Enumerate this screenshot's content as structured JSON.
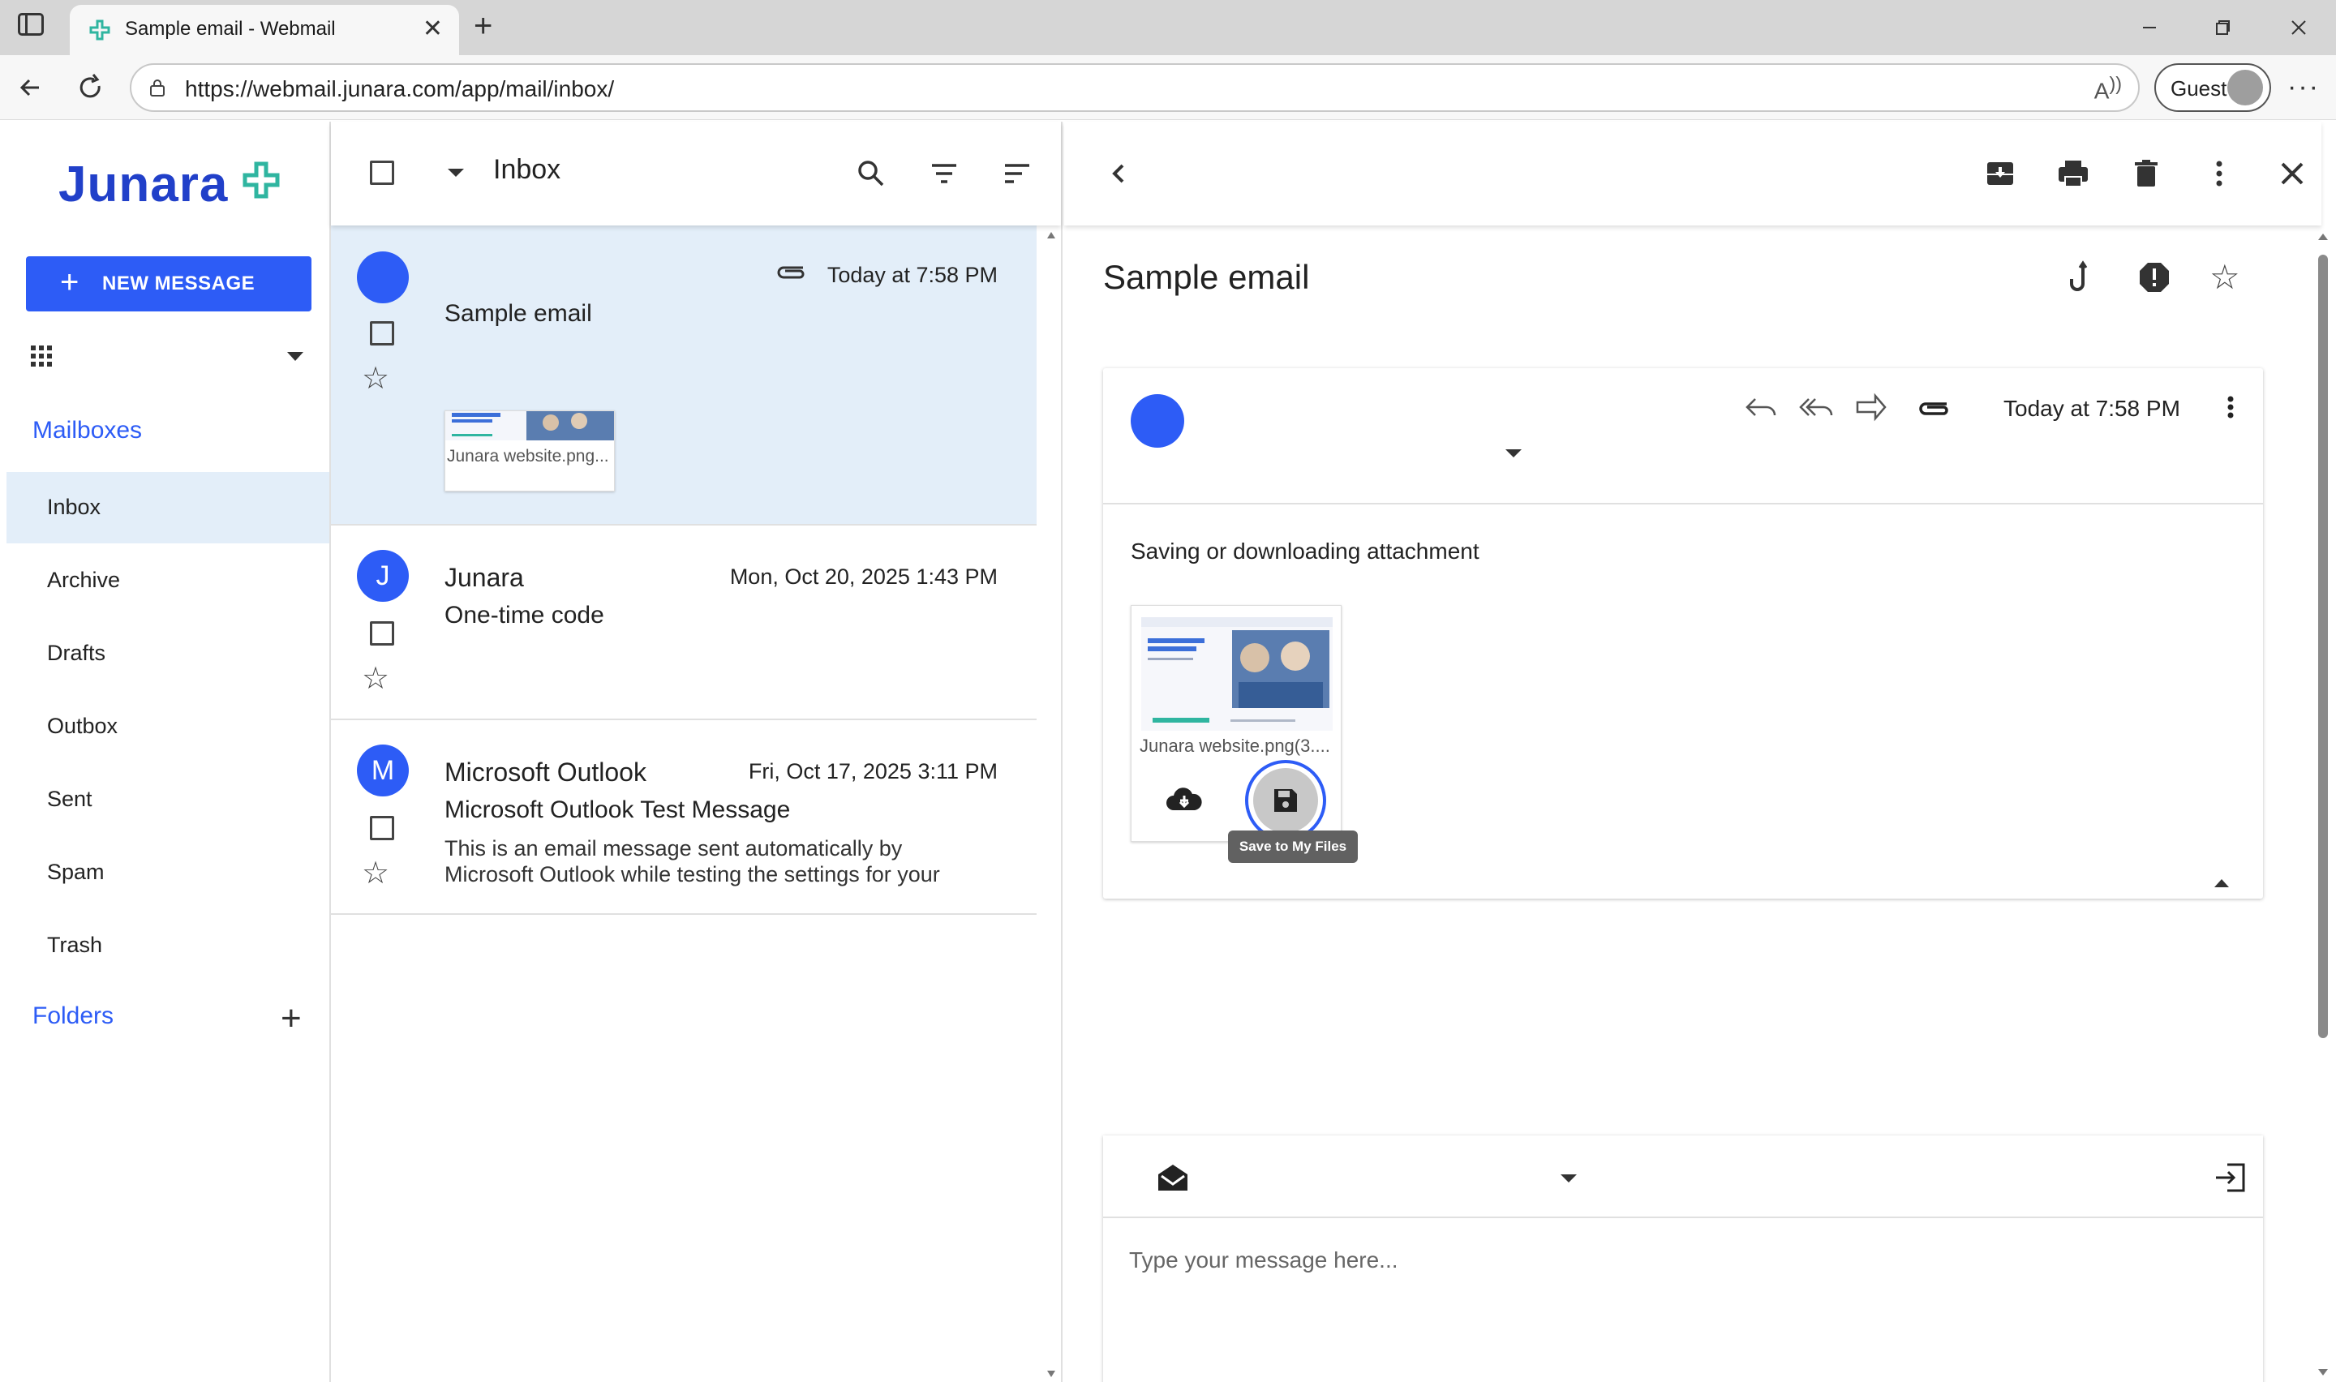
{
  "browser": {
    "tab_title": "Sample email - Webmail",
    "url": "https://webmail.junara.com/app/mail/inbox/",
    "profile_label": "Guest"
  },
  "brand": {
    "name": "Junara",
    "accent_color": "#2d5cf6"
  },
  "sidebar": {
    "new_message_label": "NEW MESSAGE",
    "mailboxes_title": "Mailboxes",
    "items": [
      {
        "label": "Inbox",
        "active": true
      },
      {
        "label": "Archive"
      },
      {
        "label": "Drafts"
      },
      {
        "label": "Outbox"
      },
      {
        "label": "Sent"
      },
      {
        "label": "Spam"
      },
      {
        "label": "Trash"
      }
    ],
    "folders_title": "Folders"
  },
  "list": {
    "title": "Inbox",
    "messages": [
      {
        "sender": "",
        "subject": "Sample email",
        "date": "Today at 7:58 PM",
        "has_attachment": true,
        "attachment_name": "Junara website.png...",
        "selected": true
      },
      {
        "avatar_letter": "J",
        "sender": "Junara",
        "subject": "One-time code",
        "date": "Mon, Oct 20, 2025 1:43 PM"
      },
      {
        "avatar_letter": "M",
        "sender": "Microsoft Outlook",
        "subject": "Microsoft Outlook Test Message",
        "date": "Fri, Oct 17, 2025 3:11 PM",
        "preview_line1": "This is an email message sent automatically by",
        "preview_line2": "Microsoft Outlook while testing the settings for your"
      }
    ]
  },
  "reader": {
    "subject": "Sample email",
    "date": "Today at 7:58 PM",
    "body": "Saving or downloading attachment",
    "attachment_name": "Junara website.png(3....",
    "save_tooltip": "Save to My Files",
    "reply_placeholder": "Type your message here..."
  }
}
